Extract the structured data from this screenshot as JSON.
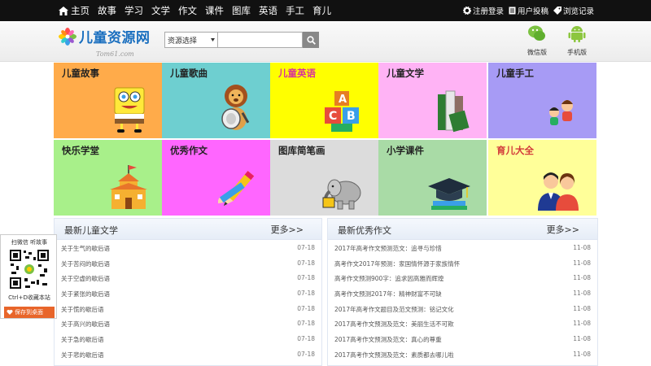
{
  "topnav": {
    "items": [
      "主页",
      "故事",
      "学习",
      "文学",
      "作文",
      "课件",
      "图库",
      "英语",
      "手工",
      "育儿"
    ],
    "right_links": [
      "注册登录",
      "用户投稿",
      "浏览记录"
    ]
  },
  "header": {
    "logo_title": "儿童资源网",
    "logo_sub": "Tom61.com",
    "search_select": "资源选择",
    "search_placeholder": "",
    "downloads": [
      {
        "label": "微信版",
        "icon": "wechat-icon"
      },
      {
        "label": "手机版",
        "icon": "android-icon"
      }
    ]
  },
  "tiles": [
    {
      "label": "儿童故事",
      "bg": "#ffab4a",
      "color": "#222",
      "icon": "spongebob-icon"
    },
    {
      "label": "儿童歌曲",
      "bg": "#6ecfd0",
      "color": "#222",
      "icon": "lion-drum-icon"
    },
    {
      "label": "儿童英语",
      "bg": "#ffff00",
      "color": "#d8339b",
      "icon": "abc-blocks-icon"
    },
    {
      "label": "儿童文学",
      "bg": "#ffb3f5",
      "color": "#222",
      "icon": "books-icon"
    },
    {
      "label": "儿童手工",
      "bg": "#a79bf5",
      "color": "#222",
      "icon": "moon-kids-icon"
    },
    {
      "label": "快乐学堂",
      "bg": "#a8f08a",
      "color": "#222",
      "icon": "school-icon"
    },
    {
      "label": "优秀作文",
      "bg": "#ff66ff",
      "color": "#222",
      "icon": "pencil-icon"
    },
    {
      "label": "图库简笔画",
      "bg": "#dcdcdc",
      "color": "#222",
      "icon": "elephant-icon"
    },
    {
      "label": "小学课件",
      "bg": "#a9dba6",
      "color": "#222",
      "icon": "grad-cap-icon"
    },
    {
      "label": "育儿大全",
      "bg": "#ffff99",
      "color": "#d23a3a",
      "icon": "parents-icon"
    }
  ],
  "left_panel": {
    "title": "最新儿童文学",
    "more": "更多>>",
    "rows": [
      {
        "title": "关于生气的歇后语",
        "date": "07-18"
      },
      {
        "title": "关于苦闷的歇后语",
        "date": "07-18"
      },
      {
        "title": "关于空虚的歇后语",
        "date": "07-18"
      },
      {
        "title": "关于紧张的歇后语",
        "date": "07-18"
      },
      {
        "title": "关于慌的歇后语",
        "date": "07-18"
      },
      {
        "title": "关于高兴的歇后语",
        "date": "07-18"
      },
      {
        "title": "关于急的歇后语",
        "date": "07-18"
      },
      {
        "title": "关于悲的歇后语",
        "date": "07-18"
      }
    ]
  },
  "right_panel": {
    "title": "最新优秀作文",
    "more": "更多>>",
    "rows": [
      {
        "title": "2017年高考作文预测范文：追寻与珍惜",
        "date": "11-08"
      },
      {
        "title": "高考作文2017年预测：家国情怀源于家族情怀",
        "date": "11-08"
      },
      {
        "title": "高考作文预测900字：追求因高雅而辉煌",
        "date": "11-08"
      },
      {
        "title": "高考作文预测2017年：精神财富不可缺",
        "date": "11-08"
      },
      {
        "title": "2017年高考作文题目及范文预测：铭记文化",
        "date": "11-08"
      },
      {
        "title": "2017高考作文预测及范文：美丽生活不可欺",
        "date": "11-08"
      },
      {
        "title": "2017高考作文预测及范文：真心的尊重",
        "date": "11-08"
      },
      {
        "title": "2017高考作文预测及范文：素质都去哪儿啦",
        "date": "11-08"
      }
    ]
  },
  "side_qr": {
    "caption_top": "扫微信 听故事",
    "caption_bottom": "Ctrl+D收藏本站",
    "save": "保存到桌面"
  }
}
